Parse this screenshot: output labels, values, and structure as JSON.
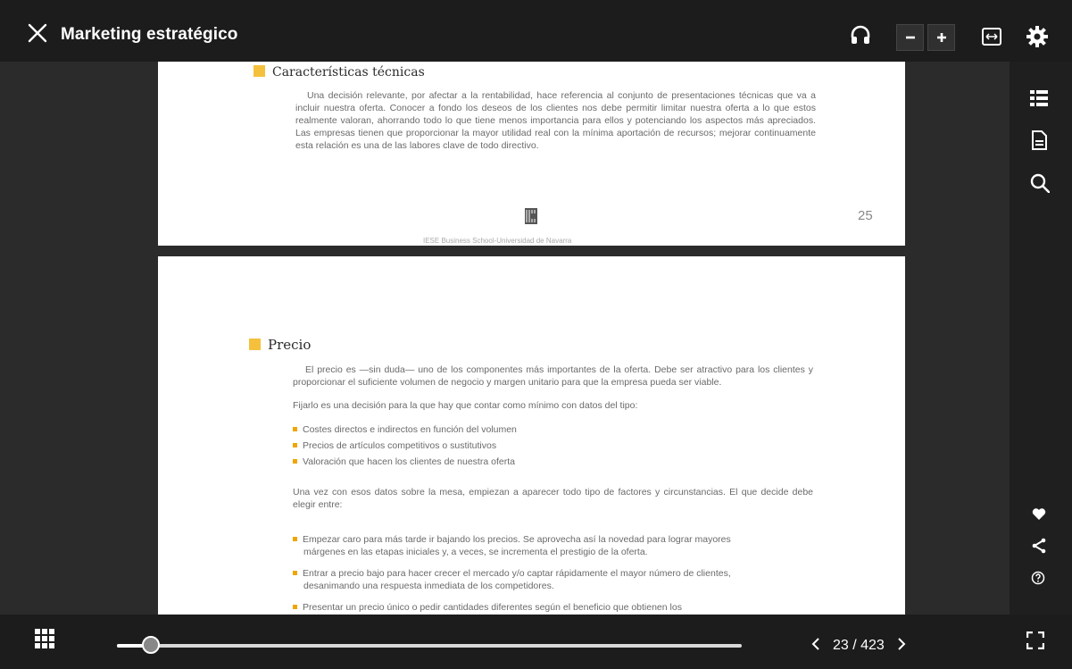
{
  "header": {
    "title": "Marketing estratégico",
    "icons": [
      "close-icon",
      "headphones-icon",
      "zoom-out-icon",
      "zoom-in-icon",
      "fit-width-icon",
      "gear-icon"
    ]
  },
  "page1": {
    "heading": "Características técnicas",
    "paragraph": "Una decisión relevante, por afectar a la rentabilidad, hace referencia al conjunto de presentaciones técnicas que va a incluir nuestra oferta. Conocer a fondo los deseos de los clientes nos debe permitir limitar nuestra oferta a lo que estos realmente valoran, ahorrando todo lo que tiene menos importancia para ellos y potenciando los aspectos más apreciados. Las empresas tienen que proporcionar la mayor utilidad real con la mínima aportación de recursos; mejorar continuamente esta relación es una de las labores clave de todo directivo.",
    "page_number": "25",
    "footer": "IESE Business School-Universidad de Navarra"
  },
  "page2": {
    "heading": "Precio",
    "para1": "El precio es —sin duda— uno de los componentes más importantes de la oferta. Debe ser atractivo para los clientes y proporcionar el suficiente volumen de negocio y margen unitario para que la empresa pueda ser viable.",
    "para2": "Fijarlo es una decisión para la que hay que contar como mínimo con datos del tipo:",
    "bullets1": [
      "Costes directos e indirectos en función del volumen",
      "Precios de artículos competitivos o sustitutivos",
      "Valoración que hacen los clientes de nuestra oferta"
    ],
    "para3": "Una vez con esos datos sobre la mesa, empiezan a aparecer todo tipo de factores y circunstancias. El que decide debe elegir entre:",
    "bullets2": [
      "Empezar caro para más tarde ir bajando los precios. Se aprovecha así la novedad para lograr mayores márgenes en las etapas iniciales y, a veces, se incrementa el prestigio de la oferta.",
      "Entrar a precio bajo para hacer crecer el mercado y/o captar rápidamente el mayor número de clientes, desanimando una respuesta inmediata de los competidores.",
      "Presentar un precio único o pedir cantidades diferentes según el beneficio que obtienen los"
    ]
  },
  "sidebar": {
    "icons": [
      "table-of-contents-icon",
      "document-icon",
      "search-icon",
      "heart-icon",
      "share-icon",
      "help-icon"
    ]
  },
  "footer": {
    "current_page": "23",
    "total_pages": "423",
    "page_label": "23 / 423",
    "progress_fraction": 0.054
  },
  "colors": {
    "accent": "#f5c13d",
    "bar": "#1c1c1c",
    "background": "#2b2b2b"
  }
}
